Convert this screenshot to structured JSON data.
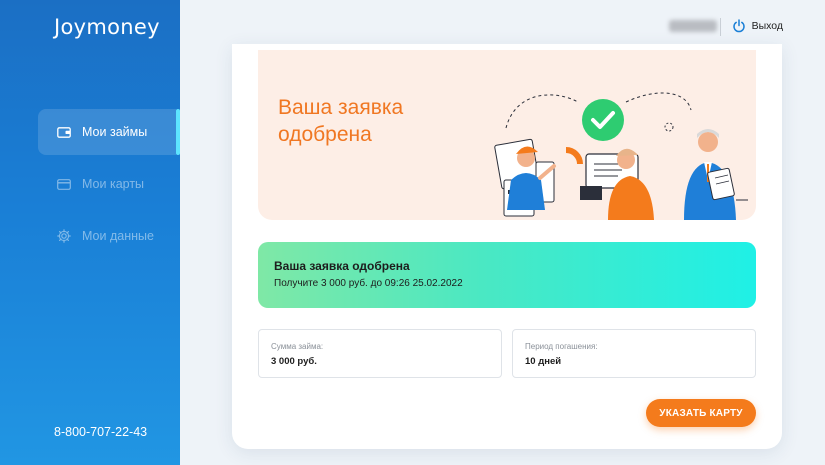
{
  "brand": {
    "logo_text": "Joymoney"
  },
  "sidebar": {
    "items": [
      {
        "label": "Мои займы",
        "icon": "wallet-icon",
        "active": true
      },
      {
        "label": "Мои карты",
        "icon": "card-icon",
        "active": false
      },
      {
        "label": "Мои данные",
        "icon": "gear-icon",
        "active": false
      }
    ],
    "phone": "8-800-707-22-43"
  },
  "topbar": {
    "logout_label": "Выход"
  },
  "hero": {
    "title": "Ваша заявка одобрена"
  },
  "approval": {
    "title": "Ваша заявка одобрена",
    "subtitle": "Получите 3 000 руб. до 09:26 25.02.2022"
  },
  "loan": {
    "amount_label": "Сумма займа:",
    "amount_value": "3 000 руб.",
    "term_label": "Период погашения:",
    "term_value": "10 дней"
  },
  "actions": {
    "primary_label": "УКАЗАТЬ КАРТУ"
  },
  "colors": {
    "accent": "#f47b1c",
    "sidebar": "#1a7fd6",
    "success": "#2ecc71"
  }
}
